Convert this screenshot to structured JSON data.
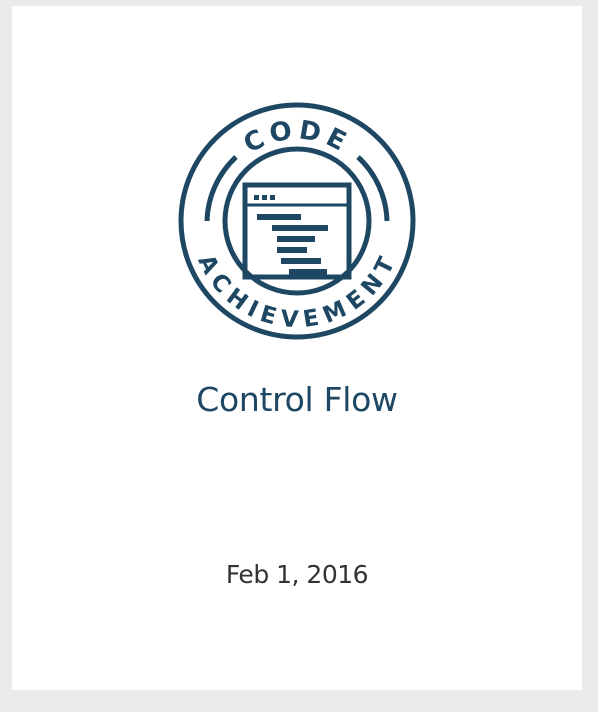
{
  "achievement": {
    "badge": {
      "icon": "code-window-icon",
      "top_text": "CODE",
      "bottom_text": "ACHIEVEMENT",
      "color": "#1e4763"
    },
    "title": "Control Flow",
    "date": "Feb 1, 2016"
  },
  "colors": {
    "background": "#ebebeb",
    "card": "#ffffff",
    "title": "#1e4763",
    "date": "#333333"
  }
}
